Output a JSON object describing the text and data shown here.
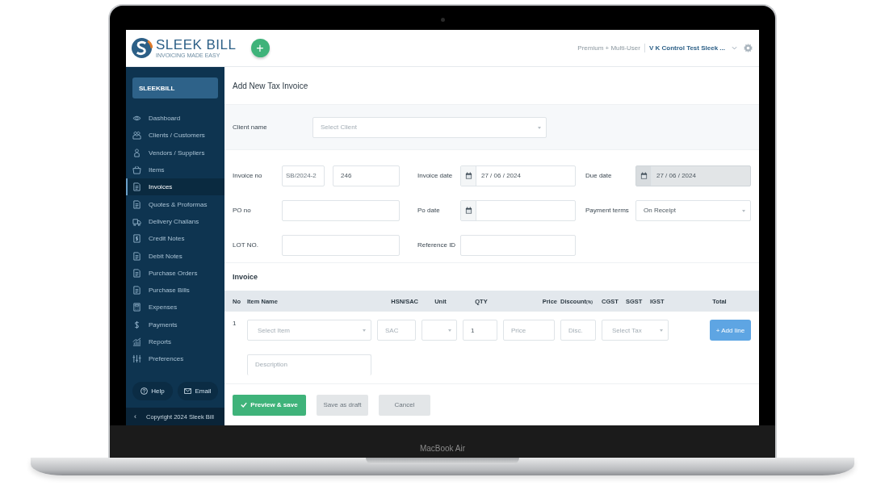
{
  "laptop": {
    "model_label": "MacBook Air"
  },
  "header": {
    "logo_name": "SLEEK BILL",
    "logo_tagline": "INVOICING MADE EASY",
    "add_button": "+",
    "plan": "Premium + Multi-User",
    "company": "V K Control Test Sleek ..."
  },
  "sidebar": {
    "account": "SLEEKBILL",
    "items": [
      {
        "label": "Dashboard",
        "kind": "eye",
        "selected": false
      },
      {
        "label": "Clients / Customers",
        "kind": "users",
        "selected": false
      },
      {
        "label": "Vendors / Suppliers",
        "kind": "user",
        "selected": false
      },
      {
        "label": "Items",
        "kind": "basket",
        "selected": false
      },
      {
        "label": "Invoices",
        "kind": "doc",
        "selected": true
      },
      {
        "label": "Quotes & Proformas",
        "kind": "doc",
        "selected": false
      },
      {
        "label": "Delivery Challans",
        "kind": "truck",
        "selected": false
      },
      {
        "label": "Credit Notes",
        "kind": "money",
        "selected": false
      },
      {
        "label": "Debit Notes",
        "kind": "doc",
        "selected": false
      },
      {
        "label": "Purchase Orders",
        "kind": "doc",
        "selected": false
      },
      {
        "label": "Purchase Bills",
        "kind": "doc",
        "selected": false
      },
      {
        "label": "Expenses",
        "kind": "calc",
        "selected": false
      },
      {
        "label": "Payments",
        "kind": "dollar",
        "selected": false
      },
      {
        "label": "Reports",
        "kind": "chart",
        "selected": false
      },
      {
        "label": "Preferences",
        "kind": "sliders",
        "selected": false
      }
    ],
    "help": "Help",
    "email": "Email",
    "collapse": "‹",
    "copyright": "Copyright 2024 Sleek Bill"
  },
  "form": {
    "title": "Add New Tax Invoice",
    "client": {
      "label": "Client name",
      "placeholder": "Select Client"
    },
    "fields": [
      {
        "label": "Invoice no",
        "kind": "split",
        "prefix": "SB/2024-2",
        "value": "246",
        "disabled": false
      },
      {
        "label": "Invoice date",
        "kind": "date",
        "value": "27 / 06 / 2024",
        "disabled": false
      },
      {
        "label": "Due date",
        "kind": "date",
        "value": "27 / 06 / 2024",
        "disabled": true
      },
      {
        "label": "PO no",
        "kind": "text",
        "disabled": false
      },
      {
        "label": "Po date",
        "kind": "date",
        "disabled": false
      },
      {
        "label": "Payment terms",
        "kind": "select",
        "value": "On Receipt",
        "disabled": false
      },
      {
        "label": "LOT NO.",
        "kind": "text",
        "disabled": false
      },
      {
        "label": "Reference ID",
        "kind": "text",
        "disabled": false
      }
    ]
  },
  "invoice": {
    "title": "Invoice",
    "columns": [
      {
        "label": "No"
      },
      {
        "label": "Item Name"
      },
      {
        "label": "HSN/SAC"
      },
      {
        "label": "Unit"
      },
      {
        "label": "QTY"
      },
      {
        "label": "Price"
      },
      {
        "label": "Discount",
        "note": "(%)"
      },
      {
        "label": "CGST"
      },
      {
        "label": "SGST"
      },
      {
        "label": "IGST"
      },
      {
        "label": "Total"
      }
    ],
    "line": {
      "no": "1",
      "item_placeholder": "Select Item",
      "hsn_placeholder": "SAC",
      "qty": "1",
      "price_placeholder": "Price",
      "discount_placeholder": "Disc.",
      "tax_placeholder": "Select Tax",
      "add_button": "+ Add line",
      "description_placeholder": "Description"
    }
  },
  "buttons": [
    {
      "label": "Preview & save",
      "kind": "primary"
    },
    {
      "label": "Save as draft",
      "kind": "secondary"
    },
    {
      "label": "Cancel",
      "kind": "secondary"
    }
  ]
}
